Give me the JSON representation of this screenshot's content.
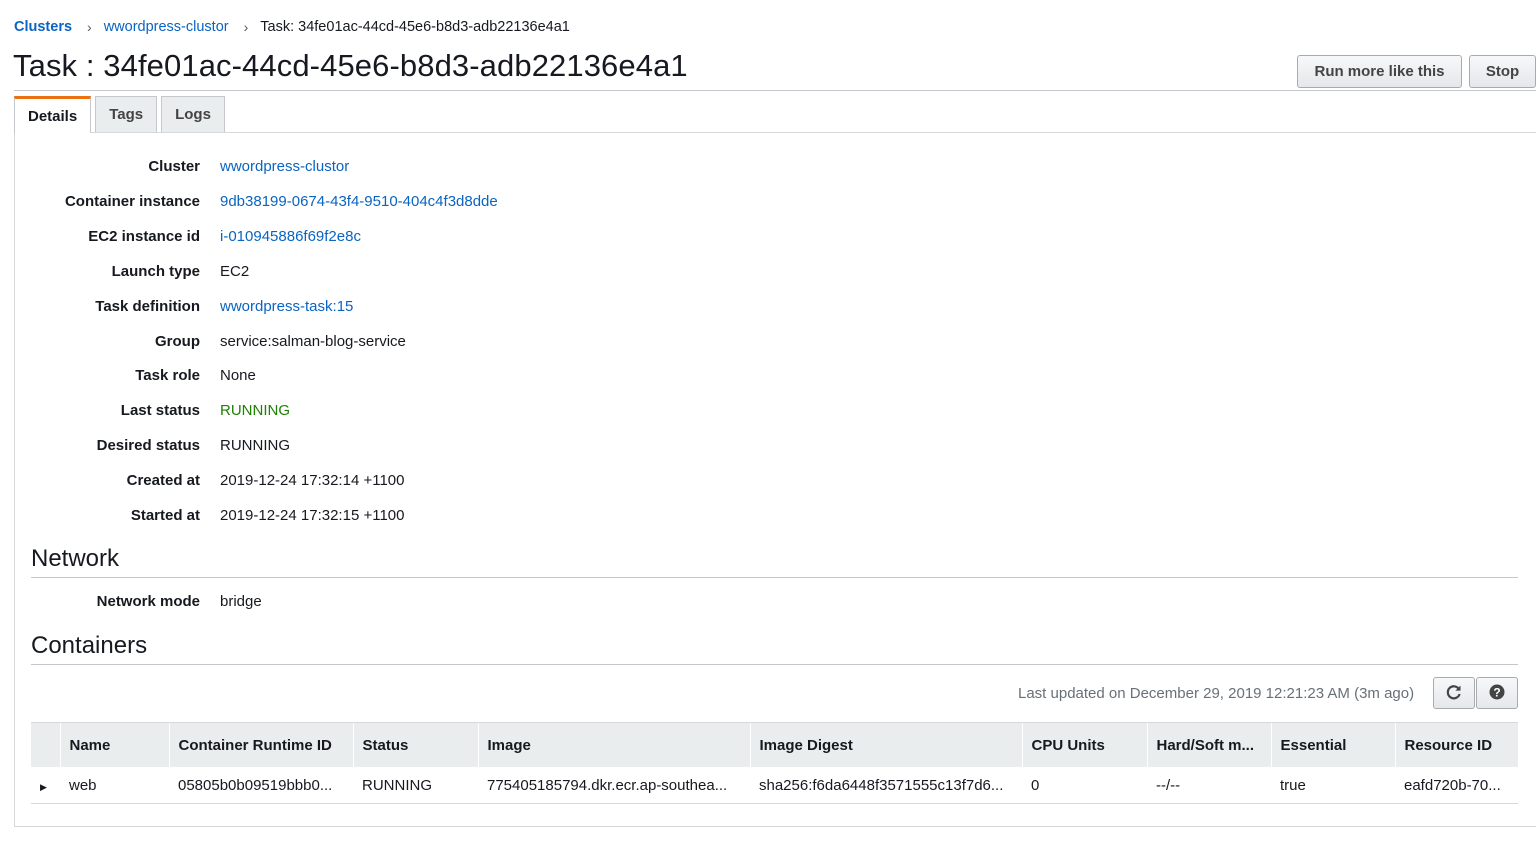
{
  "breadcrumb": {
    "clusters": "Clusters",
    "cluster": "wwordpress-clustor",
    "current": "Task: 34fe01ac-44cd-45e6-b8d3-adb22136e4a1",
    "separator": "›"
  },
  "page_title": "Task : 34fe01ac-44cd-45e6-b8d3-adb22136e4a1",
  "actions": {
    "run_more": "Run more like this",
    "stop": "Stop"
  },
  "tabs": [
    "Details",
    "Tags",
    "Logs"
  ],
  "details": {
    "cluster": {
      "label": "Cluster",
      "value": "wwordpress-clustor"
    },
    "container_instance": {
      "label": "Container instance",
      "value": "9db38199-0674-43f4-9510-404c4f3d8dde"
    },
    "ec2_instance_id": {
      "label": "EC2 instance id",
      "value": "i-010945886f69f2e8c"
    },
    "launch_type": {
      "label": "Launch type",
      "value": "EC2"
    },
    "task_definition": {
      "label": "Task definition",
      "value": "wwordpress-task:15"
    },
    "group": {
      "label": "Group",
      "value": "service:salman-blog-service"
    },
    "task_role": {
      "label": "Task role",
      "value": "None"
    },
    "last_status": {
      "label": "Last status",
      "value": "RUNNING"
    },
    "desired_status": {
      "label": "Desired status",
      "value": "RUNNING"
    },
    "created_at": {
      "label": "Created at",
      "value": "2019-12-24 17:32:14 +1100"
    },
    "started_at": {
      "label": "Started at",
      "value": "2019-12-24 17:32:15 +1100"
    }
  },
  "network": {
    "title": "Network",
    "mode_label": "Network mode",
    "mode_value": "bridge"
  },
  "containers": {
    "title": "Containers",
    "last_updated": "Last updated on December 29, 2019 12:21:23 AM (3m ago)",
    "columns": [
      "Name",
      "Container Runtime ID",
      "Status",
      "Image",
      "Image Digest",
      "CPU Units",
      "Hard/Soft m...",
      "Essential",
      "Resource ID"
    ],
    "rows": [
      {
        "name": "web",
        "runtime_id": "05805b0b09519bbb0...",
        "status": "RUNNING",
        "image": "775405185794.dkr.ecr.ap-southea...",
        "digest": "sha256:f6da6448f3571555c13f7d6...",
        "cpu": "0",
        "memory": "--/--",
        "essential": "true",
        "resource_id": "eafd720b-70..."
      }
    ]
  },
  "colors": {
    "link": "#0a64c2",
    "running": "#1d8102",
    "tab_accent": "#ec7211"
  },
  "icons": [
    "refresh-icon",
    "help-icon",
    "expand-caret-icon",
    "chevron-right-icon"
  ]
}
